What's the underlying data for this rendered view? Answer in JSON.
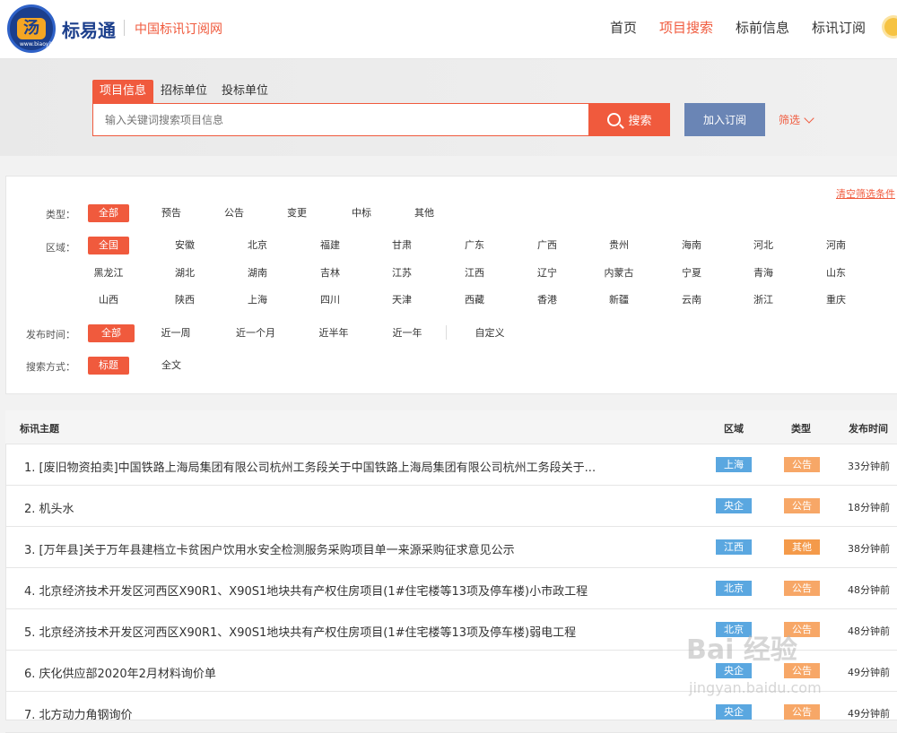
{
  "header": {
    "logo_text": "汤",
    "logo_mini": "www.biaoyitong.cn",
    "brand": "标易通",
    "brand_sub": "中国标讯订阅网",
    "nav": [
      "首页",
      "项目搜索",
      "标前信息",
      "标讯订阅"
    ],
    "nav_active": 1
  },
  "search": {
    "tabs": [
      "项目信息",
      "招标单位",
      "投标单位"
    ],
    "active_tab": 0,
    "placeholder": "输入关键词搜索项目信息",
    "search_label": "搜索",
    "subscribe_label": "加入订阅",
    "filter_label": "筛选"
  },
  "filters": {
    "clear_label": "清空筛选条件",
    "type_label": "类型：",
    "types": [
      "全部",
      "预告",
      "公告",
      "变更",
      "中标",
      "其他"
    ],
    "region_label": "区域：",
    "regions": [
      "全国",
      "安徽",
      "北京",
      "福建",
      "甘肃",
      "广东",
      "广西",
      "贵州",
      "海南",
      "河北",
      "河南",
      "黑龙江",
      "湖北",
      "湖南",
      "吉林",
      "江苏",
      "江西",
      "辽宁",
      "内蒙古",
      "宁夏",
      "青海",
      "山东",
      "山西",
      "陕西",
      "上海",
      "四川",
      "天津",
      "西藏",
      "香港",
      "新疆",
      "云南",
      "浙江",
      "重庆"
    ],
    "time_label": "发布时间：",
    "times": [
      "全部",
      "近一周",
      "近一个月",
      "近半年",
      "近一年",
      "自定义"
    ],
    "mode_label": "搜索方式：",
    "modes": [
      "标题",
      "全文"
    ]
  },
  "table": {
    "headers": [
      "标讯主题",
      "区域",
      "类型",
      "发布时间"
    ],
    "rows": [
      {
        "title": "1. [废旧物资拍卖]中国铁路上海局集团有限公司杭州工务段关于中国铁路上海局集团有限公司杭州工务段关于...",
        "region": "上海",
        "type": "公告",
        "time": "33分钟前"
      },
      {
        "title": "2. 机头水",
        "region": "央企",
        "type": "公告",
        "time": "18分钟前"
      },
      {
        "title": "3. [万年县]关于万年县建档立卡贫困户饮用水安全检测服务采购项目单一来源采购征求意见公示",
        "region": "江西",
        "type": "其他",
        "time": "38分钟前"
      },
      {
        "title": "4. 北京经济技术开发区河西区X90R1、X90S1地块共有产权住房项目(1#住宅楼等13项及停车楼)小市政工程",
        "region": "北京",
        "type": "公告",
        "time": "48分钟前"
      },
      {
        "title": "5. 北京经济技术开发区河西区X90R1、X90S1地块共有产权住房项目(1#住宅楼等13项及停车楼)弱电工程",
        "region": "北京",
        "type": "公告",
        "time": "48分钟前"
      },
      {
        "title": "6. 庆化供应部2020年2月材料询价单",
        "region": "央企",
        "type": "公告",
        "time": "49分钟前"
      },
      {
        "title": "7. 北方动力角钢询价",
        "region": "央企",
        "type": "公告",
        "time": "49分钟前"
      }
    ]
  },
  "watermark": {
    "main": "Bai 经验",
    "sub": "jingyan.baidu.com"
  }
}
